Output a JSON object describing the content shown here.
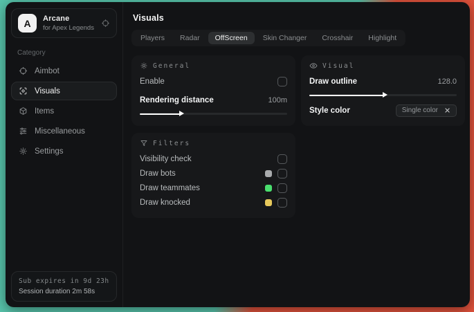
{
  "app": {
    "logo_letter": "A",
    "name": "Arcane",
    "subtitle": "for Apex Legends"
  },
  "sidebar": {
    "category_label": "Category",
    "items": [
      {
        "label": "Aimbot",
        "icon": "crosshair-icon"
      },
      {
        "label": "Visuals",
        "icon": "eye-scan-icon",
        "active": true
      },
      {
        "label": "Items",
        "icon": "package-icon"
      },
      {
        "label": "Miscellaneous",
        "icon": "sliders-icon"
      },
      {
        "label": "Settings",
        "icon": "gear-icon"
      }
    ],
    "footer": {
      "sub_expires": "Sub expires in 9d 23h",
      "session_duration": "Session duration 2m 58s"
    }
  },
  "main": {
    "title": "Visuals",
    "tabs": [
      {
        "label": "Players"
      },
      {
        "label": "Radar"
      },
      {
        "label": "OffScreen",
        "active": true
      },
      {
        "label": "Skin Changer"
      },
      {
        "label": "Crosshair"
      },
      {
        "label": "Highlight"
      }
    ],
    "general_panel": {
      "title": "General",
      "icon": "sun-icon",
      "enable_label": "Enable",
      "enable_checked": false,
      "rendering_distance_label": "Rendering distance",
      "rendering_distance_value": "100m",
      "rendering_distance_percent": 27
    },
    "visual_panel": {
      "title": "Visual",
      "icon": "eye-icon",
      "draw_outline_label": "Draw outline",
      "draw_outline_value": "128.0",
      "draw_outline_percent": 50,
      "style_color_label": "Style color",
      "style_color_value": "Single color"
    },
    "filters_panel": {
      "title": "Filters",
      "icon": "funnel-icon",
      "rows": [
        {
          "label": "Visibility check",
          "checked": false
        },
        {
          "label": "Draw bots",
          "swatch": "#a9abad",
          "checked": false
        },
        {
          "label": "Draw teammates",
          "swatch": "#4ade6e",
          "checked": false
        },
        {
          "label": "Draw knocked",
          "swatch": "#e7c95c",
          "checked": false
        }
      ]
    }
  },
  "colors": {
    "desktop_teal": "#57c3aa",
    "desktop_red": "#e0523c",
    "window_bg": "#121315",
    "panel_bg": "#17181a",
    "swatch_gray": "#a9abad",
    "swatch_green": "#4ade6e",
    "swatch_yellow": "#e7c95c"
  }
}
